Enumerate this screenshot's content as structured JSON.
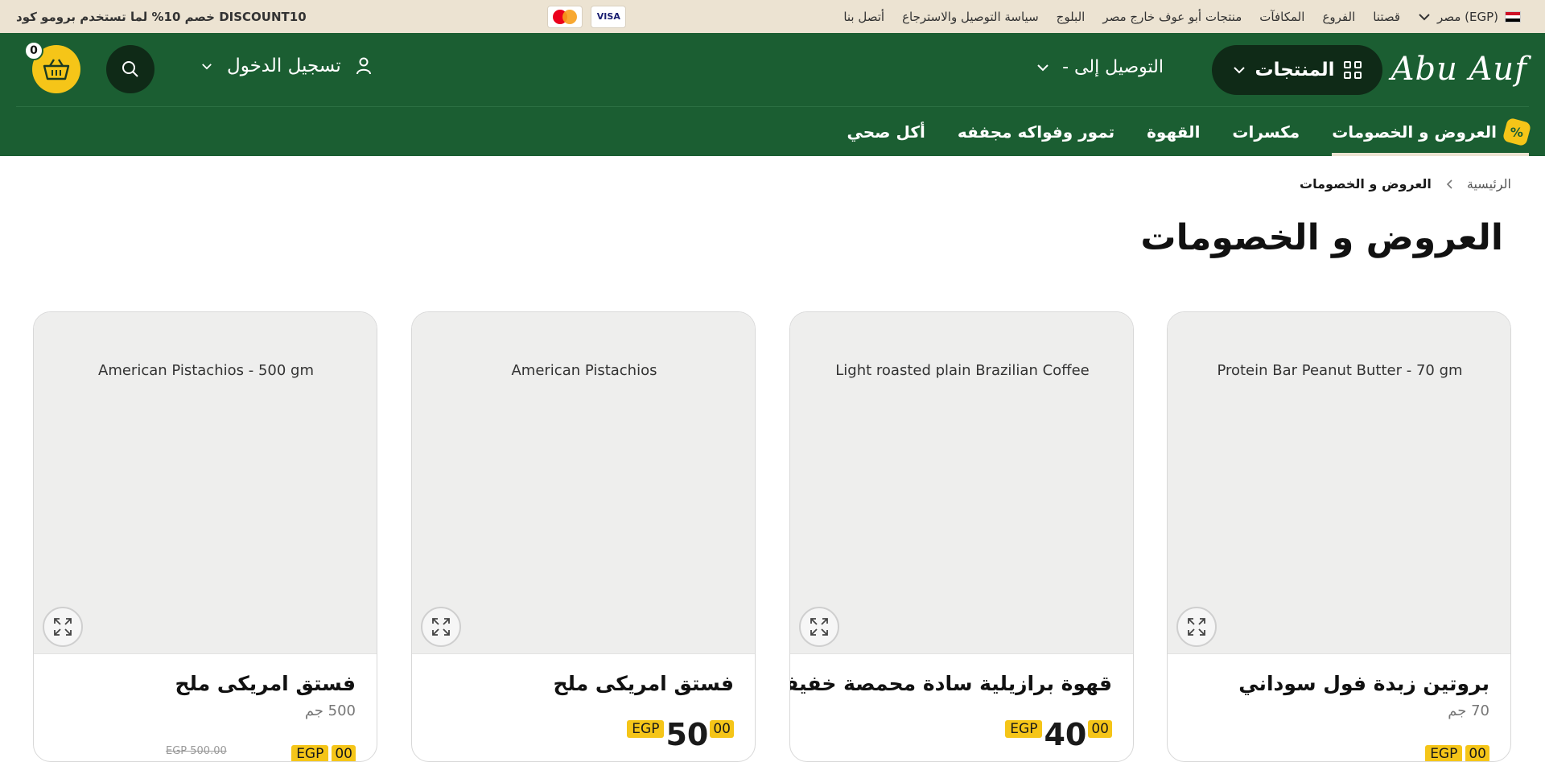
{
  "topbar": {
    "promo": "خصم 10% لما تستخدم برومو كود DISCOUNT10",
    "visa_label": "VISA",
    "links": [
      "أتصل بنا",
      "سياسة التوصيل والاسترجاع",
      "البلوج",
      "منتجات أبو عوف خارج مصر",
      "المكافآت",
      "الفروع",
      "قصتنا"
    ],
    "country": "مصر (EGP)"
  },
  "header": {
    "logo": "Abu Auf",
    "products_label": "المنتجات",
    "deliver_label": "التوصيل إلى -",
    "login_label": "تسجيل الدخول",
    "cart_count": "0"
  },
  "nav": {
    "items": [
      "العروض و الخصومات",
      "مكسرات",
      "القهوة",
      "تمور وفواكه مجففه",
      "أكل صحي"
    ],
    "badge": "%"
  },
  "breadcrumb": {
    "home": "الرئيسية",
    "current": "العروض و الخصومات"
  },
  "page_title": "العروض و الخصومات",
  "colors": {
    "brand_green": "#1b5e32",
    "dark_green": "#0f2a17",
    "accent_yellow": "#f5c518",
    "topbar_beige": "#ece3d2"
  },
  "products": [
    {
      "image_alt": "Protein Bar Peanut Butter - 70 gm",
      "name": "بروتين زبدة فول سوداني",
      "weight": "70 جم",
      "currency": "EGP",
      "price_whole": "",
      "price_cents": "00",
      "old_price": ""
    },
    {
      "image_alt": "Light roasted plain Brazilian Coffee",
      "name": "قهوة برازيلية سادة محمصة خفيفة",
      "weight": "",
      "currency": "EGP",
      "price_whole": "40",
      "price_cents": "00",
      "old_price": ""
    },
    {
      "image_alt": "American Pistachios",
      "name": "فستق امريكى ملح",
      "weight": "",
      "currency": "EGP",
      "price_whole": "50",
      "price_cents": "00",
      "old_price": ""
    },
    {
      "image_alt": "American Pistachios - 500 gm",
      "name": "فستق امريكى ملح",
      "weight": "500 جم",
      "currency": "EGP",
      "price_whole": "",
      "price_cents": "00",
      "old_price": "EGP 500.00"
    }
  ]
}
